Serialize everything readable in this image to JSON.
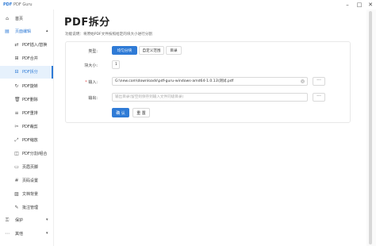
{
  "window": {
    "logo": "PDF",
    "title": "PDF Guru",
    "min": "–",
    "max": "□",
    "close": "✕"
  },
  "sidebar": {
    "items": [
      {
        "label": "首页",
        "icon": "home-icon",
        "glyph": "⌂"
      },
      {
        "label": "页面编辑",
        "icon": "edit-pages-icon",
        "glyph": "▤",
        "chevron": "▴"
      },
      {
        "label": "PDF插入/替换",
        "icon": "insert-icon",
        "glyph": "⇄"
      },
      {
        "label": "PDF合并",
        "icon": "merge-icon",
        "glyph": "⊞"
      },
      {
        "label": "PDF拆分",
        "icon": "split-icon",
        "glyph": "⊟"
      },
      {
        "label": "PDF旋转",
        "icon": "rotate-icon",
        "glyph": "↻"
      },
      {
        "label": "PDF删除",
        "icon": "delete-icon",
        "glyph": "🗑"
      },
      {
        "label": "PDF重排",
        "icon": "reorder-icon",
        "glyph": "≡"
      },
      {
        "label": "PDF裁剪",
        "icon": "crop-icon",
        "glyph": "✂"
      },
      {
        "label": "PDF缩放",
        "icon": "scale-icon",
        "glyph": "⤢"
      },
      {
        "label": "PDF分割/组合",
        "icon": "cut-combine-icon",
        "glyph": "◫"
      },
      {
        "label": "页眉页脚",
        "icon": "header-footer-icon",
        "glyph": "▭"
      },
      {
        "label": "页码设置",
        "icon": "page-number-icon",
        "glyph": "#"
      },
      {
        "label": "文档背景",
        "icon": "background-icon",
        "glyph": "▨"
      },
      {
        "label": "批注管理",
        "icon": "annotation-icon",
        "glyph": "✎"
      },
      {
        "label": "保护",
        "icon": "protect-icon",
        "glyph": "⚿",
        "chevron": "▾"
      },
      {
        "label": "其他",
        "icon": "other-icon",
        "glyph": "⋯",
        "chevron": "▾"
      }
    ]
  },
  "main": {
    "title": "PDF拆分",
    "description": "功能说明：将原始PDF文件按照给定的块大小进行分割",
    "form": {
      "type_label": "类型:",
      "type_options": [
        "均匀分块",
        "自定义范围",
        "目录"
      ],
      "chunk_label": "块大小:",
      "chunk_value": "1",
      "input_label": "输入:",
      "input_required": "*",
      "input_value": "G:\\new.com\\downloads\\pdf-guru-windows-amd64-1.0.13\\测试.pdf",
      "output_label": "输出:",
      "output_placeholder": "输出目录(留空则保存到输入文件同级目录)",
      "browse": "···",
      "clear": "×",
      "confirm": "确 认",
      "reset": "重 置"
    }
  },
  "colors": {
    "accent": "#2f7bd6",
    "active_bg": "#e6f1fc"
  }
}
